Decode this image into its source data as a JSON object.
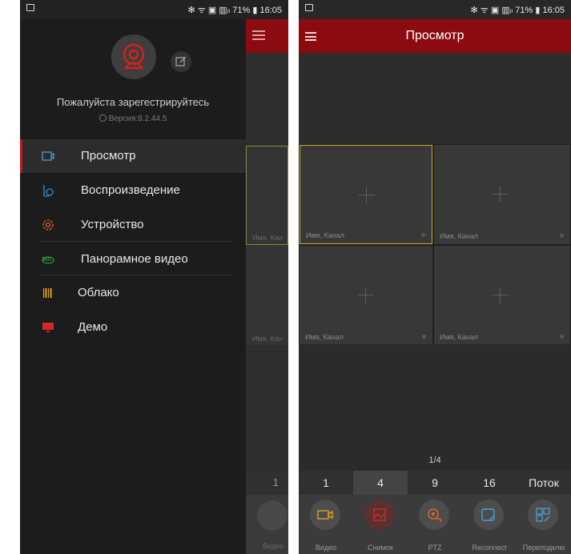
{
  "status_bar": {
    "left_time_text": "✻ ᯤ ▣ ▥ᵢₗ 71% ▮ 16:05",
    "right_time_text": "✻ ᯤ ▣ ▥ᵢₗ 71% ▮ 16:05"
  },
  "drawer": {
    "register_text": "Пожалуйста зарегестрируйтесь",
    "version_text": "Версия:8.2.44.5",
    "items": [
      {
        "label": "Просмотр",
        "icon": "camera-icon",
        "color": "#4a9fd6",
        "active": true
      },
      {
        "label": "Воспроизведение",
        "icon": "playback-icon",
        "color": "#3b8ed0"
      },
      {
        "label": "Устройство",
        "icon": "device-gear-icon",
        "color": "#e0682a"
      },
      {
        "label": "Панорамное видео",
        "icon": "panorama-360-icon",
        "color": "#39b54a"
      },
      {
        "label": "Облако",
        "icon": "cloud-barcode-icon",
        "color": "#e0a020"
      },
      {
        "label": "Демо",
        "icon": "demo-monitor-icon",
        "color": "#d22a2a"
      }
    ]
  },
  "left_background": {
    "tile_label_1": "Имя, Кан",
    "tile_label_2": "Имя, Кан",
    "split_value": "1",
    "toolbar_label": "Видео"
  },
  "main": {
    "title": "Просмотр",
    "tiles": [
      {
        "label": "Имя, Канал",
        "selected": true
      },
      {
        "label": "Имя, Канал",
        "selected": false
      },
      {
        "label": "Имя, Канал",
        "selected": false
      },
      {
        "label": "Имя, Канал",
        "selected": false
      }
    ],
    "page_indicator": "1/4",
    "split_options": [
      "1",
      "4",
      "9",
      "16",
      "Поток"
    ],
    "split_active": "4",
    "toolbar": [
      {
        "label": "Видео",
        "icon": "video-camera-icon",
        "color": "#e0a020"
      },
      {
        "label": "Снимок",
        "icon": "snapshot-icon",
        "color": "#d22a2a"
      },
      {
        "label": "PTZ",
        "icon": "ptz-icon",
        "color": "#e0682a"
      },
      {
        "label": "Reconnect",
        "icon": "reconnect-icon",
        "color": "#4a9fd6"
      },
      {
        "label": "Переподклю",
        "icon": "reconnect-grid-icon",
        "color": "#4a9fd6"
      }
    ]
  },
  "colors": {
    "accent_red": "#8c0b10",
    "selected_tile_border": "#c8b12a"
  }
}
